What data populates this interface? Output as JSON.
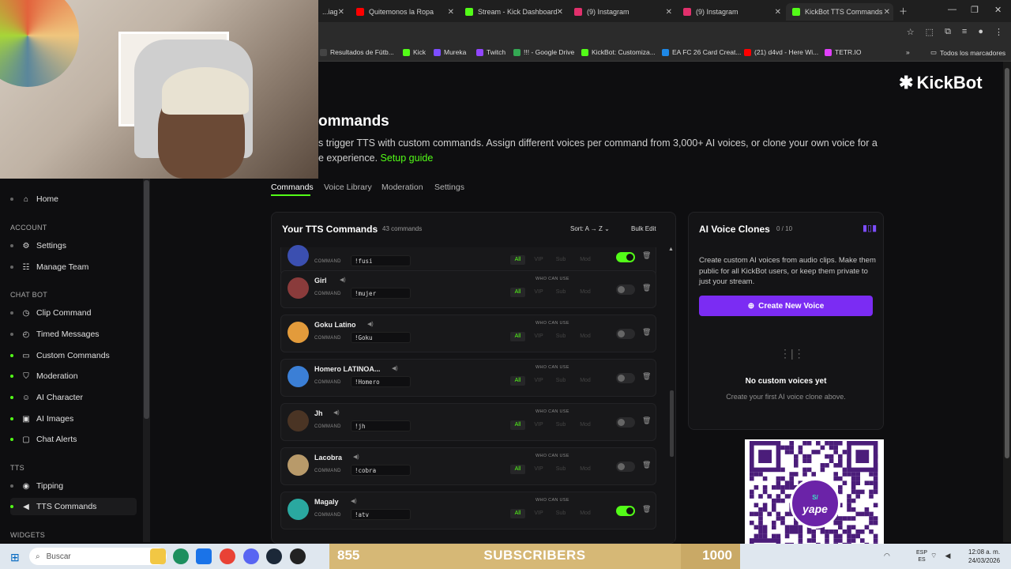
{
  "browser": {
    "tabs": [
      {
        "label": "...iag",
        "color": "#888888"
      },
      {
        "label": "Quitemonos la Ropa",
        "color": "#ff0000"
      },
      {
        "label": "Stream - Kick Dashboard",
        "color": "#53fc18"
      },
      {
        "label": "(9) Instagram",
        "color": "#e1306c"
      },
      {
        "label": "(9) Instagram",
        "color": "#e1306c"
      },
      {
        "label": "KickBot TTS Commands",
        "color": "#53fc18"
      }
    ],
    "bookmarks": [
      {
        "label": "Resultados de Fútb...",
        "color": "#444444"
      },
      {
        "label": "Kick",
        "color": "#53fc18"
      },
      {
        "label": "Mureka",
        "color": "#7c4dff"
      },
      {
        "label": "Twitch",
        "color": "#9146ff"
      },
      {
        "label": "!!! - Google Drive",
        "color": "#34a853"
      },
      {
        "label": "KickBot: Customiza...",
        "color": "#53fc18"
      },
      {
        "label": "EA FC 26 Card Creat...",
        "color": "#1e88e5"
      },
      {
        "label": "(21) d4vd - Here Wi...",
        "color": "#ff0000"
      },
      {
        "label": "TETR.IO",
        "color": "#e040fb"
      }
    ],
    "all_bookmarks": "Todos los marcadores"
  },
  "brand": {
    "name": "KickBot"
  },
  "page": {
    "title": "ommands",
    "description": "s trigger TTS with custom commands. Assign different voices per command from 3,000+ AI voices, or clone your own voice for a",
    "description2": "e experience.",
    "setup_link": "Setup guide"
  },
  "sidebar": {
    "home": "Home",
    "account_head": "ACCOUNT",
    "settings": "Settings",
    "manage_team": "Manage Team",
    "chatbot_head": "CHAT BOT",
    "clip": "Clip Command",
    "timed": "Timed Messages",
    "custom": "Custom Commands",
    "moderation": "Moderation",
    "ai_character": "AI Character",
    "ai_images": "AI Images",
    "chat_alerts": "Chat Alerts",
    "tts_head": "TTS",
    "tipping": "Tipping",
    "tts_commands": "TTS Commands",
    "widgets_head": "WIDGETS"
  },
  "tabs": {
    "commands": "Commands",
    "voice_library": "Voice Library",
    "moderation": "Moderation",
    "settings": "Settings"
  },
  "commands_panel": {
    "title": "Your TTS Commands",
    "count": "43 commands",
    "sort": "Sort: A → Z",
    "bulk_edit": "Bulk Edit",
    "command_label": "COMMAND",
    "who_label": "WHO CAN USE",
    "perm_all": "All",
    "perm_vip": "VIP",
    "perm_sub": "Sub",
    "perm_mod": "Mod",
    "rows": [
      {
        "name": "",
        "command": "!fusi",
        "enabled": true,
        "avatar": "#3b4fb0"
      },
      {
        "name": "Girl",
        "command": "!mujer",
        "enabled": false,
        "avatar": "#8a3b3b"
      },
      {
        "name": "Goku Latino",
        "command": "!Goku",
        "enabled": false,
        "avatar": "#e39b3b"
      },
      {
        "name": "Homero LATINOA...",
        "command": "!Homero",
        "enabled": false,
        "avatar": "#3b7fd6"
      },
      {
        "name": "Jh",
        "command": "!jh",
        "enabled": false,
        "avatar": "#4a3424"
      },
      {
        "name": "Lacobra",
        "command": "!cobra",
        "enabled": false,
        "avatar": "#b89a6a"
      },
      {
        "name": "Magaly",
        "command": "!atv",
        "enabled": true,
        "avatar": "#2aa8a0"
      }
    ]
  },
  "voice_clones": {
    "title": "AI Voice Clones",
    "count": "0 / 10",
    "description": "Create custom AI voices from audio clips. Make them public for all KickBot users, or keep them private to just your stream.",
    "button": "Create New Voice",
    "empty_title": "No custom voices yet",
    "empty_sub": "Create your first AI voice clone above."
  },
  "qr": {
    "brand": "yape",
    "symbol": "S/"
  },
  "subscribers": {
    "current": "855",
    "label": "SUBSCRIBERS",
    "goal": "1000",
    "progress": 0.855
  },
  "taskbar": {
    "search": "Buscar",
    "lang1": "ESP",
    "lang2": "ES",
    "time": "12:08 a. m.",
    "date": "24/03/2026"
  }
}
